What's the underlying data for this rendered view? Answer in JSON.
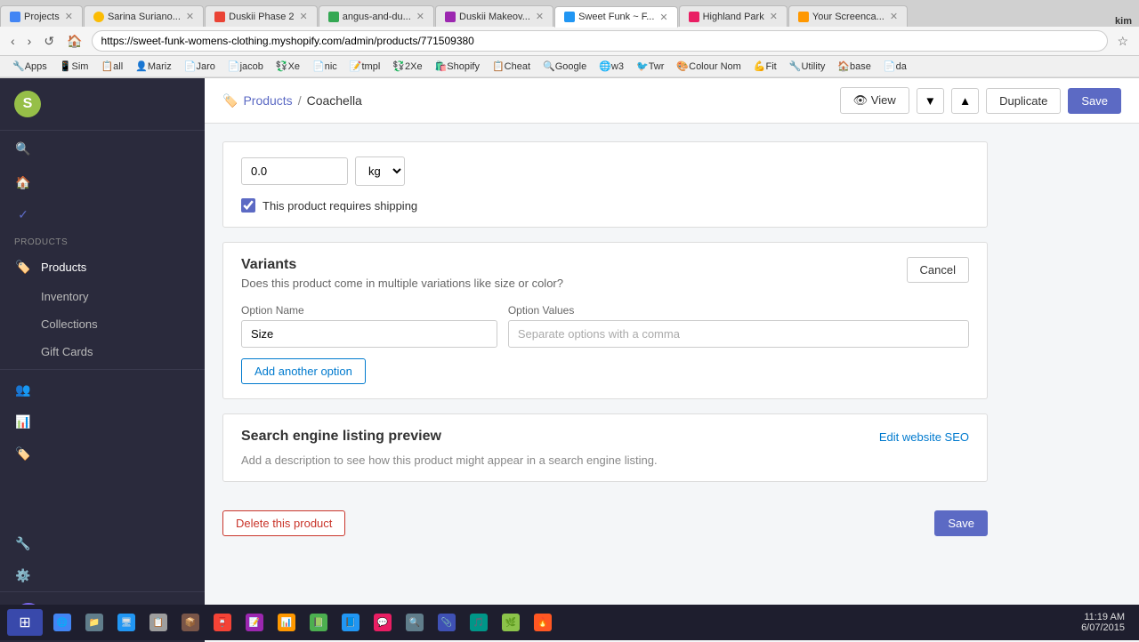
{
  "browser": {
    "tabs": [
      {
        "id": 1,
        "label": "Projects",
        "favicon_color": "#4285f4",
        "active": false
      },
      {
        "id": 2,
        "label": "Sarina Suriano...",
        "favicon_color": "#fbbc04",
        "active": false
      },
      {
        "id": 3,
        "label": "Duskii Phase 2",
        "favicon_color": "#ea4335",
        "active": false
      },
      {
        "id": 4,
        "label": "angus-and-du...",
        "favicon_color": "#34a853",
        "active": false
      },
      {
        "id": 5,
        "label": "Duskii Makeov...",
        "favicon_color": "#9c27b0",
        "active": false
      },
      {
        "id": 6,
        "label": "Sweet Funk ~ F...",
        "favicon_color": "#2196f3",
        "active": true
      },
      {
        "id": 7,
        "label": "Highland Park",
        "favicon_color": "#e91e63",
        "active": false
      },
      {
        "id": 8,
        "label": "Your Screenca...",
        "favicon_color": "#ff9800",
        "active": false
      }
    ],
    "address": "https://sweet-funk-womens-clothing.myshopify.com/admin/products/771509380",
    "user": "kim",
    "bookmarks": [
      {
        "label": "Apps",
        "favicon": "🔧"
      },
      {
        "label": "Sim",
        "favicon": "📱"
      },
      {
        "label": "all",
        "favicon": "📋"
      },
      {
        "label": "Mariz",
        "favicon": "👤"
      },
      {
        "label": "Jaro",
        "favicon": "📄"
      },
      {
        "label": "jacob",
        "favicon": "📄"
      },
      {
        "label": "Xe",
        "favicon": "💱"
      },
      {
        "label": "nic",
        "favicon": "📄"
      },
      {
        "label": "tmpl",
        "favicon": "📝"
      },
      {
        "label": "2Xe",
        "favicon": "💱"
      },
      {
        "label": "Shopify",
        "favicon": "🛍️"
      },
      {
        "label": "Cheat",
        "favicon": "📋"
      },
      {
        "label": "Google",
        "favicon": "🔍"
      },
      {
        "label": "w3",
        "favicon": "🌐"
      },
      {
        "label": "Twr",
        "favicon": "🐦"
      },
      {
        "label": "Colour Nom",
        "favicon": "🎨"
      },
      {
        "label": "Fit",
        "favicon": "💪"
      },
      {
        "label": "Utility",
        "favicon": "🔧"
      },
      {
        "label": "base",
        "favicon": "🏠"
      },
      {
        "label": "da",
        "favicon": "📄"
      }
    ]
  },
  "sidebar": {
    "logo_letter": "S",
    "products_label": "PRODUCTS",
    "nav_items": [
      {
        "id": "search",
        "label": "",
        "icon": "🔍"
      },
      {
        "id": "home",
        "label": "",
        "icon": "🏠"
      },
      {
        "id": "orders",
        "label": "",
        "icon": "✓"
      },
      {
        "id": "products",
        "label": "Products",
        "icon": "🏷️",
        "active": true
      },
      {
        "id": "inventory",
        "label": "Inventory",
        "icon": ""
      },
      {
        "id": "collections",
        "label": "Collections",
        "icon": ""
      },
      {
        "id": "gift-cards",
        "label": "Gift Cards",
        "icon": ""
      }
    ],
    "bottom_items": [
      {
        "id": "customers",
        "icon": "👥"
      },
      {
        "id": "reports",
        "icon": "📊"
      },
      {
        "id": "discounts",
        "icon": "🏷️"
      },
      {
        "id": "apps",
        "icon": "🔧"
      },
      {
        "id": "settings",
        "icon": "⚙️"
      }
    ]
  },
  "header": {
    "breadcrumb_parent": "Products",
    "breadcrumb_separator": "/",
    "breadcrumb_current": "Coachella",
    "view_label": "View",
    "duplicate_label": "Duplicate",
    "save_label": "Save"
  },
  "shipping": {
    "weight_value": "0.0",
    "weight_unit": "kg",
    "shipping_label": "This product requires shipping",
    "checkbox_checked": true
  },
  "variants": {
    "title": "Variants",
    "description": "Does this product come in multiple variations like size or color?",
    "cancel_label": "Cancel",
    "option_name_label": "Option Name",
    "option_values_label": "Option Values",
    "option_name_value": "Size",
    "option_values_placeholder": "Separate options with a comma",
    "add_option_label": "Add another option"
  },
  "seo": {
    "title": "Search engine listing preview",
    "edit_link": "Edit website SEO",
    "description": "Add a description to see how this product might appear in a search engine listing."
  },
  "bottom_actions": {
    "delete_label": "Delete this product",
    "save_label": "Save"
  },
  "taskbar": {
    "clock": "11:19 AM",
    "date": "6/07/2015",
    "items": [
      {
        "label": "Chrome",
        "color": "#4285f4"
      },
      {
        "label": "Files",
        "color": "#607d8b"
      },
      {
        "label": "",
        "color": "#2196f3"
      },
      {
        "label": "",
        "color": "#9e9e9e"
      },
      {
        "label": "",
        "color": "#795548"
      },
      {
        "label": "",
        "color": "#f44336"
      },
      {
        "label": "",
        "color": "#9c27b0"
      },
      {
        "label": "",
        "color": "#ff9800"
      },
      {
        "label": "",
        "color": "#4caf50"
      },
      {
        "label": "",
        "color": "#2196f3"
      },
      {
        "label": "",
        "color": "#e91e63"
      },
      {
        "label": "",
        "color": "#607d8b"
      },
      {
        "label": "",
        "color": "#3f51b5"
      },
      {
        "label": "",
        "color": "#009688"
      },
      {
        "label": "",
        "color": "#8bc34a"
      },
      {
        "label": "",
        "color": "#ff5722"
      }
    ]
  }
}
